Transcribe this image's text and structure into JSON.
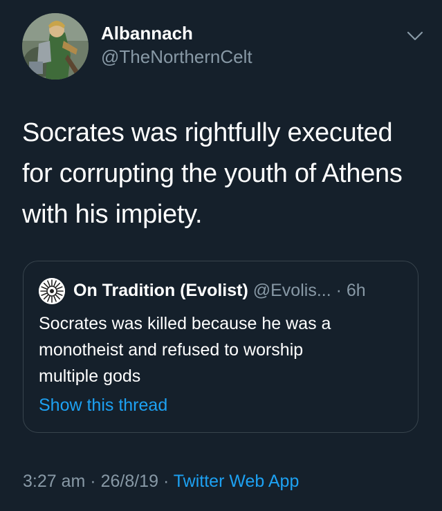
{
  "author": {
    "display_name": "Albannach",
    "handle": "@TheNorthernCelt",
    "avatar_icon": "warrior-portrait-avatar"
  },
  "tweet": {
    "lines": [
      "Socrates was rightfully executed",
      "for corrupting the youth of Athens",
      "with his impiety."
    ]
  },
  "quoted_tweet": {
    "display_name": "On Tradition (Evolist)",
    "handle": "@Evolis...",
    "separator": "·",
    "time": "6h",
    "avatar_icon": "sun-emblem-avatar",
    "lines": [
      "Socrates was killed because he was a",
      "monotheist and refused to worship",
      "multiple gods"
    ],
    "show_thread_label": "Show this thread"
  },
  "meta": {
    "time": "3:27 am",
    "separator": "·",
    "date": "26/8/19",
    "source": "Twitter Web App"
  },
  "colors": {
    "background": "#15202b",
    "text": "#ffffff",
    "muted": "#8899a6",
    "link": "#1da1f2",
    "border": "#38444d"
  }
}
